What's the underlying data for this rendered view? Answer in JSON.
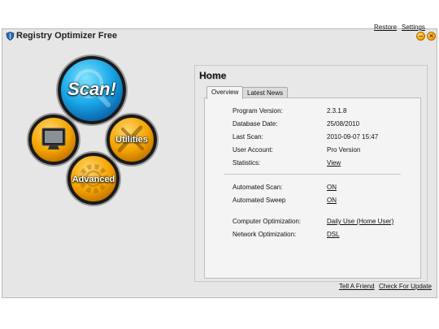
{
  "window": {
    "title": "Registry Optimizer Free"
  },
  "top_links": {
    "restore": "Restore",
    "settings": "Settings"
  },
  "orbs": {
    "scan": "Scan!",
    "utilities": "Utilities",
    "advanced": "Advanced"
  },
  "home": {
    "title": "Home",
    "tabs": [
      "Overview",
      "Latest News"
    ],
    "info": [
      {
        "label": "Program Version:",
        "value": "2.3.1.8"
      },
      {
        "label": "Database Date:",
        "value": "25/08/2010"
      },
      {
        "label": "Last Scan:",
        "value": "2010-09-07 15:47"
      },
      {
        "label": "User Account:",
        "value": "Pro Version"
      },
      {
        "label": "Statistics:",
        "value": "View"
      }
    ],
    "automation": [
      {
        "label": "Automated Scan:",
        "value": "ON"
      },
      {
        "label": "Automated Sweep",
        "value": "ON"
      }
    ],
    "optimization": [
      {
        "label": "Computer Optimization:",
        "value": "Daily Use (Home User)"
      },
      {
        "label": "Network Optimization:",
        "value": "DSL"
      }
    ]
  },
  "footer": {
    "tell_friend": "Tell A Friend",
    "check_update": "Check For Update"
  }
}
